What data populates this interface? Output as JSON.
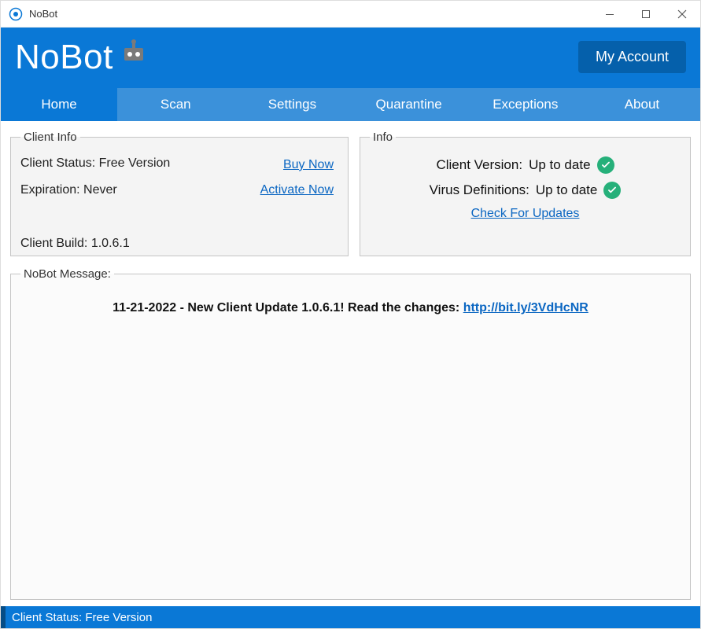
{
  "titlebar": {
    "title": "NoBot"
  },
  "header": {
    "brand": "NoBot",
    "account_button": "My Account"
  },
  "tabs": [
    {
      "label": "Home",
      "active": true
    },
    {
      "label": "Scan",
      "active": false
    },
    {
      "label": "Settings",
      "active": false
    },
    {
      "label": "Quarantine",
      "active": false
    },
    {
      "label": "Exceptions",
      "active": false
    },
    {
      "label": "About",
      "active": false
    }
  ],
  "client_info": {
    "legend": "Client Info",
    "status_label": "Client Status:",
    "status_value": "Free Version",
    "expiration_label": "Expiration:",
    "expiration_value": "Never",
    "build_label": "Client Build:",
    "build_value": "1.0.6.1",
    "buy_link": "Buy Now",
    "activate_link": "Activate Now"
  },
  "info": {
    "legend": "Info",
    "version_label": "Client Version:",
    "version_value": "Up to date",
    "defs_label": "Virus Definitions:",
    "defs_value": "Up to date",
    "updates_link": "Check For Updates"
  },
  "message": {
    "legend": "NoBot Message:",
    "date": "11-21-2022",
    "text": "New Client Update 1.0.6.1! Read the changes:",
    "link_text": "http://bit.ly/3VdHcNR"
  },
  "statusbar": {
    "text": "Client Status: Free Version"
  }
}
